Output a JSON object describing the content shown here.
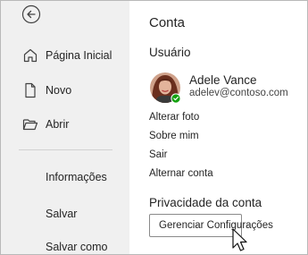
{
  "colors": {
    "sidebar_bg": "#f0f0f0",
    "presence_green": "#13a10e",
    "text": "#242424"
  },
  "sidebar": {
    "back_icon": "back-arrow-icon",
    "nav_items": [
      {
        "label": "Página Inicial",
        "icon": "home-icon"
      },
      {
        "label": "Novo",
        "icon": "new-document-icon"
      },
      {
        "label": "Abrir",
        "icon": "open-folder-icon"
      }
    ],
    "text_items": [
      {
        "label": "Informações"
      },
      {
        "label": "Salvar"
      },
      {
        "label": "Salvar como"
      }
    ]
  },
  "main": {
    "title": "Conta",
    "user_section": {
      "heading": "Usuário",
      "name": "Adele Vance",
      "email": "adelev@contoso.com",
      "presence": "available",
      "links": [
        "Alterar foto",
        "Sobre mim",
        "Sair",
        "Alternar conta"
      ]
    },
    "privacy_section": {
      "heading": "Privacidade da conta",
      "button_label": "Gerenciar Configurações"
    }
  }
}
